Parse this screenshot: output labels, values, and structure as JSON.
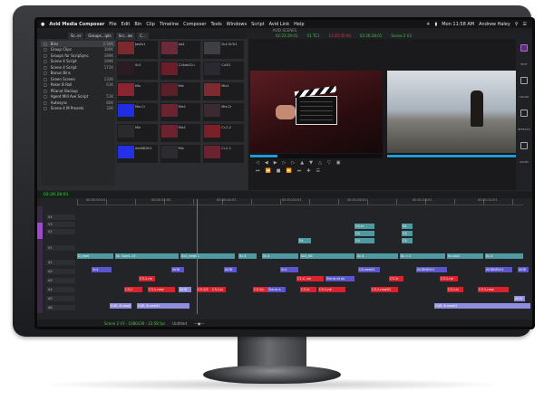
{
  "menubar": {
    "apple": "",
    "app_name": "Avid Media Composer",
    "items": [
      "File",
      "Edit",
      "Bin",
      "Clip",
      "Timeline",
      "Composer",
      "Tools",
      "Windows",
      "Script",
      "Avid Link",
      "Help"
    ],
    "time": "Mon 11:58 AM",
    "user": "Andrew Haley"
  },
  "window_title": "AVID SCENES",
  "bin": {
    "tabs": [
      "Sc..er",
      "Groups...ipts",
      "Scr...ies",
      "C..."
    ],
    "rows": [
      {
        "label": "Bins",
        "size": "2.56K",
        "selected": true
      },
      {
        "label": "Group Clips",
        "size": "380K",
        "selected": false
      },
      {
        "label": "Groups for ScripSync",
        "size": "189K",
        "selected": false
      },
      {
        "label": "Scene 4 Script",
        "size": "189K",
        "selected": false
      },
      {
        "label": "Scene 4 Script",
        "size": "172K",
        "selected": false
      },
      {
        "label": "Bonus Bins",
        "size": "",
        "selected": false
      },
      {
        "label": "Green Screen",
        "size": "132K",
        "selected": false
      },
      {
        "label": "Poker B Roll",
        "size": "61K",
        "selected": false
      },
      {
        "label": "PEanut Backup",
        "size": "",
        "selected": false
      },
      {
        "label": "Agent Mill Ave Script",
        "size": "51K",
        "selected": false
      },
      {
        "label": "Autosync",
        "size": "80K",
        "selected": false
      },
      {
        "label": "Scene 4 M Presets",
        "size": "32K",
        "selected": false
      }
    ],
    "thumbs": [
      {
        "caption": "Jas0s1",
        "color": "#7a2a2c"
      },
      {
        "caption": "Jas1",
        "color": "#6b2a3a"
      },
      {
        "caption": "Sc4 ScTc1",
        "color": "#3e3f44"
      },
      {
        "caption": "Sc3",
        "color": "#2b1b22"
      },
      {
        "caption": "124ab1Cu",
        "color": "#6b1e2a"
      },
      {
        "caption": "Cu3l1",
        "color": "#2a2830"
      },
      {
        "caption": "Mix",
        "color": "#8a2430"
      },
      {
        "caption": "Mix",
        "color": "#5a1f28"
      },
      {
        "caption": "Mix1",
        "color": "#7d2a30"
      },
      {
        "caption": "Mix.Cr",
        "color": "#1e2ee0"
      },
      {
        "caption": "Mix1",
        "color": "#6a2430"
      },
      {
        "caption": "Mix.Cr",
        "color": "#3a2b30"
      },
      {
        "caption": "Mix",
        "color": "#2a2a2e"
      },
      {
        "caption": "Mix1",
        "color": "#6e2230"
      },
      {
        "caption": "Cr-2-2",
        "color": "#7a2028"
      },
      {
        "caption": "AvidNDVr1",
        "color": "#2230e8"
      },
      {
        "caption": "Mix",
        "color": "#2c2c30"
      },
      {
        "caption": "Cr-2-1",
        "color": "#6a2230"
      }
    ]
  },
  "viewer": {
    "timecode_left": "02:23:19:01",
    "timecode_mid": "V1 TC1",
    "timecode_right": "13:25:35:04",
    "timecode_right2": "02:26:28:01",
    "sequence": "Scene 2 V3"
  },
  "rightbar": {
    "items": [
      "EDIT",
      "COLOR",
      "EFFECTS",
      "AUDIO"
    ]
  },
  "timeline": {
    "timecode": "02:26:28:01",
    "ruler_labels": [
      "00:00:00:01",
      "00:00:32:00",
      "00:00:44:01",
      "00:01:00:01",
      "00:01:08:01",
      "00:01:16:01",
      "00:01:24:01"
    ],
    "tracks": [
      "V4",
      "V3",
      "V2",
      "V1",
      "A1",
      "A2",
      "A3",
      "A4",
      "A5",
      "A6"
    ],
    "clips_v": [
      {
        "text": "D_coet",
        "track": 3,
        "start": 44,
        "len": 40
      },
      {
        "text": "Sc. Sce4...t1",
        "track": 3,
        "start": 86,
        "len": 70
      },
      {
        "text": "Sc2_new01",
        "track": 3,
        "start": 158,
        "len": 60
      },
      {
        "text": "Sc.4",
        "track": 3,
        "start": 222,
        "len": 20
      },
      {
        "text": "Sc.4",
        "track": 3,
        "start": 248,
        "len": 40
      },
      {
        "text": "Sc2_N1",
        "track": 3,
        "start": 290,
        "len": 60
      },
      {
        "text": "Sc.4",
        "track": 3,
        "start": 352,
        "len": 46
      },
      {
        "text": "Sc. r 2",
        "track": 3,
        "start": 400,
        "len": 50
      },
      {
        "text": "Sc.cto2",
        "track": 3,
        "start": 452,
        "len": 40
      },
      {
        "text": "Sc.4",
        "track": 3,
        "start": 494,
        "len": 42
      },
      {
        "text": "C4.cr",
        "track": 0,
        "start": 350,
        "len": 22
      },
      {
        "text": "C4",
        "track": 1,
        "start": 350,
        "len": 22
      },
      {
        "text": "C4",
        "track": 2,
        "start": 350,
        "len": 22
      },
      {
        "text": "S4",
        "track": 0,
        "start": 402,
        "len": 12
      },
      {
        "text": "C4",
        "track": 1,
        "start": 402,
        "len": 12
      },
      {
        "text": "C4",
        "track": 2,
        "start": 402,
        "len": 12
      },
      {
        "text": "S4",
        "track": 2,
        "start": 288,
        "len": 14
      }
    ],
    "clips_a": [
      {
        "text": "Sc4",
        "row": 0,
        "start": 60,
        "len": 22,
        "kind": "cb"
      },
      {
        "text": "AVID",
        "row": 0,
        "start": 148,
        "len": 14,
        "kind": "cb"
      },
      {
        "text": "AVID",
        "row": 0,
        "start": 206,
        "len": 14,
        "kind": "cb"
      },
      {
        "text": "Sc4",
        "row": 0,
        "start": 268,
        "len": 20,
        "kind": "cb"
      },
      {
        "text": "C8-new01",
        "row": 0,
        "start": 354,
        "len": 24,
        "kind": "cb"
      },
      {
        "text": "AVIDNDVr1",
        "row": 0,
        "start": 418,
        "len": 34,
        "kind": "cb"
      },
      {
        "text": "AVIDNDVr1",
        "row": 0,
        "start": 494,
        "len": 30,
        "kind": "cb"
      },
      {
        "text": "AVID",
        "row": 0,
        "start": 530,
        "len": 12,
        "kind": "cb"
      },
      {
        "text": "C3-1-ne",
        "row": 1,
        "start": 112,
        "len": 18,
        "kind": "cr"
      },
      {
        "text": "C1-C..bn",
        "row": 1,
        "start": 286,
        "len": 30,
        "kind": "cr"
      },
      {
        "text": "Sierra at ok",
        "row": 1,
        "start": 318,
        "len": 32,
        "kind": "cb"
      },
      {
        "text": "C3-1r",
        "row": 1,
        "start": 388,
        "len": 16,
        "kind": "cr"
      },
      {
        "text": "C3-1-ne",
        "row": 1,
        "start": 444,
        "len": 20,
        "kind": "cr"
      },
      {
        "text": "C3-1",
        "row": 2,
        "start": 96,
        "len": 20,
        "kind": "cr"
      },
      {
        "text": "C3-1-new",
        "row": 2,
        "start": 122,
        "len": 30,
        "kind": "cr"
      },
      {
        "text": "AVID",
        "row": 2,
        "start": 156,
        "len": 14,
        "kind": "cl"
      },
      {
        "text": "C3-1/5",
        "row": 2,
        "start": 176,
        "len": 18,
        "kind": "cr"
      },
      {
        "text": "C3-1-b",
        "row": 2,
        "start": 192,
        "len": 16,
        "kind": "cr"
      },
      {
        "text": "C3-1/c",
        "row": 2,
        "start": 238,
        "len": 16,
        "kind": "cr"
      },
      {
        "text": "Sierra a",
        "row": 2,
        "start": 254,
        "len": 20,
        "kind": "cb"
      },
      {
        "text": "C3-1r",
        "row": 2,
        "start": 290,
        "len": 18,
        "kind": "cr"
      },
      {
        "text": "C3-1-ne",
        "row": 2,
        "start": 310,
        "len": 30,
        "kind": "cr"
      },
      {
        "text": "C3-1-new01",
        "row": 2,
        "start": 368,
        "len": 30,
        "kind": "cr"
      },
      {
        "text": "C3-1-b",
        "row": 2,
        "start": 452,
        "len": 18,
        "kind": "cr"
      },
      {
        "text": "C3-1-new",
        "row": 2,
        "start": 486,
        "len": 34,
        "kind": "cr"
      },
      {
        "text": "AVID",
        "row": 3,
        "start": 526,
        "len": 12,
        "kind": "cl"
      },
      {
        "text": "CUE: 8 new01",
        "row": 4,
        "start": 80,
        "len": 24,
        "kind": "cl"
      },
      {
        "text": "CUE: 8 new01",
        "row": 4,
        "start": 110,
        "len": 58,
        "kind": "cl"
      },
      {
        "text": "CUE: 8 new01",
        "row": 4,
        "start": 438,
        "len": 106,
        "kind": "cl"
      }
    ],
    "footer_sequence": "Scene 2 V3 - 1080i/30 - 23:58 fps",
    "footer_zoom": "Untitled"
  }
}
